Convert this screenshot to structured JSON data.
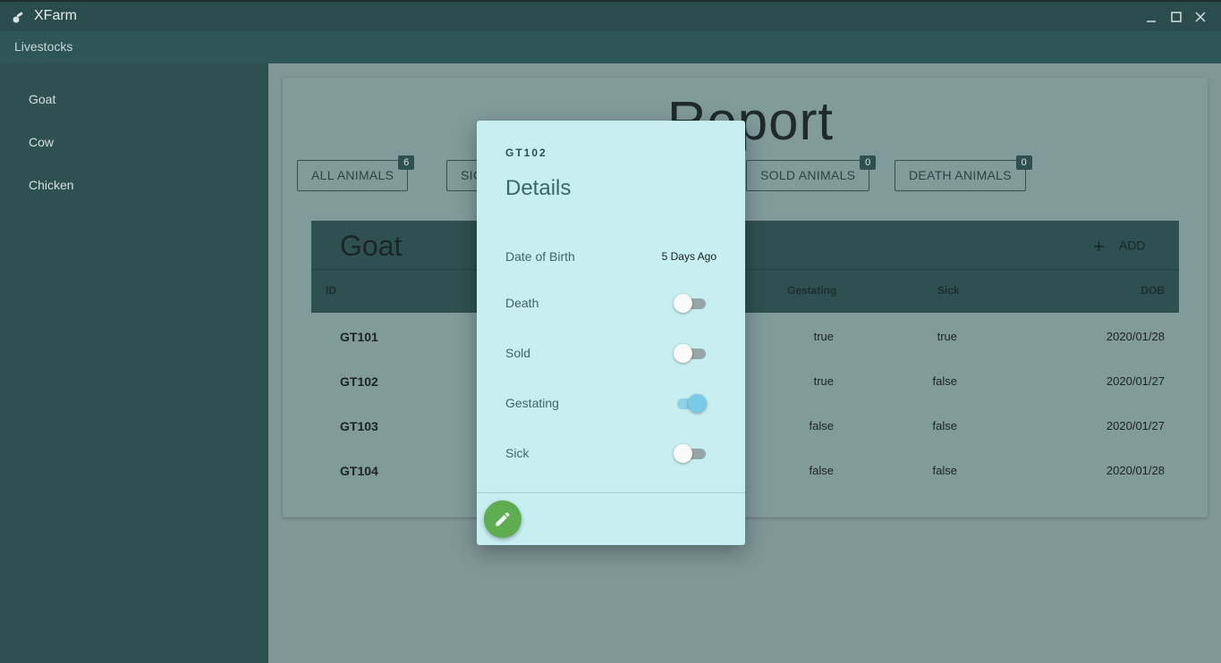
{
  "window": {
    "title": "XFarm"
  },
  "appbar": {
    "title": "Livestocks"
  },
  "sidebar": {
    "items": [
      {
        "label": "Goat"
      },
      {
        "label": "Cow"
      },
      {
        "label": "Chicken"
      }
    ]
  },
  "report": {
    "title": "Report",
    "filters": [
      {
        "label": "ALL ANIMALS",
        "count": "6"
      },
      {
        "label": "SIC",
        "count": ""
      },
      {
        "label": "SOLD ANIMALS",
        "count": "0"
      },
      {
        "label": "DEATH ANIMALS",
        "count": "0"
      }
    ]
  },
  "table": {
    "title": "Goat",
    "add_label": "ADD",
    "columns": [
      "ID",
      "Gestating",
      "Sick",
      "DOB"
    ],
    "rows": [
      {
        "id": "GT101",
        "gestating": "true",
        "sick": "true",
        "dob": "2020/01/28"
      },
      {
        "id": "GT102",
        "gestating": "true",
        "sick": "false",
        "dob": "2020/01/27"
      },
      {
        "id": "GT103",
        "gestating": "false",
        "sick": "false",
        "dob": "2020/01/27"
      },
      {
        "id": "GT104",
        "gestating": "false",
        "sick": "false",
        "dob": "2020/01/28"
      }
    ]
  },
  "dialog": {
    "id": "GT102",
    "title": "Details",
    "dob_label": "Date of Birth",
    "dob_value": "5 Days Ago",
    "toggles": [
      {
        "label": "Death",
        "on": false
      },
      {
        "label": "Sold",
        "on": false
      },
      {
        "label": "Gestating",
        "on": true
      },
      {
        "label": "Sick",
        "on": false
      }
    ],
    "edit_icon": "pencil-icon"
  },
  "colors": {
    "accent": "#2e5050",
    "dialog_bg": "#c7eef1",
    "fab": "#5ead51",
    "toggle_on": "#7ac9e6"
  }
}
